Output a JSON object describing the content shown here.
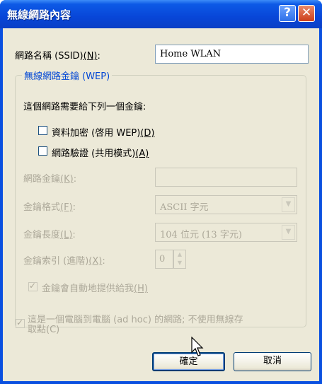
{
  "window": {
    "title": "無線網路內容",
    "help_button": "?",
    "close_button": "✕"
  },
  "ssid": {
    "label": "網路名稱 (SSID)",
    "accel": "(N)",
    "label_tail": ":",
    "value": "Home WLAN"
  },
  "wep_group": {
    "title": "無線網路金鑰 (WEP)",
    "instruction": "這個網路需要給下列一個金鑰:",
    "data_encryption": {
      "label": "資料加密 (啓用 WEP)",
      "accel": "(D)",
      "checked": false
    },
    "network_auth": {
      "label": "網路驗證 (共用模式)",
      "accel": "(A)",
      "checked": false
    },
    "network_key": {
      "label": "網路金鑰",
      "accel": "(K)",
      "label_tail": ":",
      "value": ""
    },
    "key_format": {
      "label": "金鑰格式",
      "accel": "(F)",
      "label_tail": ":",
      "value": "ASCII 字元"
    },
    "key_length": {
      "label": "金鑰長度",
      "accel": "(L)",
      "label_tail": ":",
      "value": "104 位元 (13 字元)"
    },
    "key_index": {
      "label": "金鑰索引 (進階)",
      "accel": "(X)",
      "label_tail": ":",
      "value": "0"
    },
    "auto_key": {
      "label": "金鑰會自動地提供給我",
      "accel": "(H)",
      "checked": true
    }
  },
  "adhoc": {
    "label_line1": "這是一個電腦到電腦 (ad hoc) 的網路; 不使用無線存",
    "label_line2": "取點(C)",
    "checked": true
  },
  "buttons": {
    "ok": "確定",
    "cancel": "取消"
  }
}
